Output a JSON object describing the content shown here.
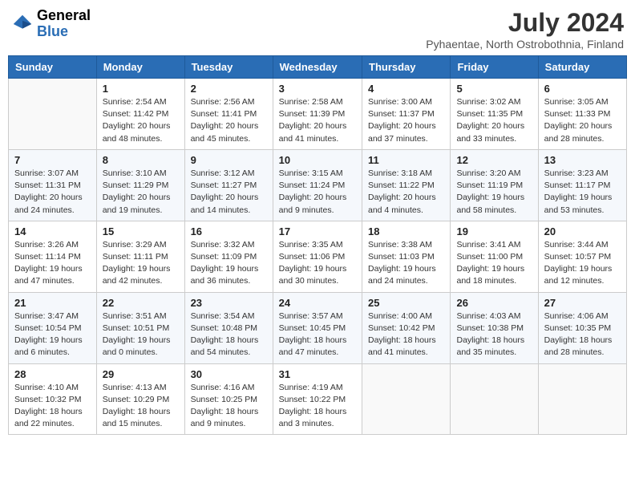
{
  "logo": {
    "text_general": "General",
    "text_blue": "Blue"
  },
  "header": {
    "month_year": "July 2024",
    "location": "Pyhaentae, North Ostrobothnia, Finland"
  },
  "weekdays": [
    "Sunday",
    "Monday",
    "Tuesday",
    "Wednesday",
    "Thursday",
    "Friday",
    "Saturday"
  ],
  "weeks": [
    [
      {
        "day": "",
        "info": ""
      },
      {
        "day": "1",
        "info": "Sunrise: 2:54 AM\nSunset: 11:42 PM\nDaylight: 20 hours\nand 48 minutes."
      },
      {
        "day": "2",
        "info": "Sunrise: 2:56 AM\nSunset: 11:41 PM\nDaylight: 20 hours\nand 45 minutes."
      },
      {
        "day": "3",
        "info": "Sunrise: 2:58 AM\nSunset: 11:39 PM\nDaylight: 20 hours\nand 41 minutes."
      },
      {
        "day": "4",
        "info": "Sunrise: 3:00 AM\nSunset: 11:37 PM\nDaylight: 20 hours\nand 37 minutes."
      },
      {
        "day": "5",
        "info": "Sunrise: 3:02 AM\nSunset: 11:35 PM\nDaylight: 20 hours\nand 33 minutes."
      },
      {
        "day": "6",
        "info": "Sunrise: 3:05 AM\nSunset: 11:33 PM\nDaylight: 20 hours\nand 28 minutes."
      }
    ],
    [
      {
        "day": "7",
        "info": "Sunrise: 3:07 AM\nSunset: 11:31 PM\nDaylight: 20 hours\nand 24 minutes."
      },
      {
        "day": "8",
        "info": "Sunrise: 3:10 AM\nSunset: 11:29 PM\nDaylight: 20 hours\nand 19 minutes."
      },
      {
        "day": "9",
        "info": "Sunrise: 3:12 AM\nSunset: 11:27 PM\nDaylight: 20 hours\nand 14 minutes."
      },
      {
        "day": "10",
        "info": "Sunrise: 3:15 AM\nSunset: 11:24 PM\nDaylight: 20 hours\nand 9 minutes."
      },
      {
        "day": "11",
        "info": "Sunrise: 3:18 AM\nSunset: 11:22 PM\nDaylight: 20 hours\nand 4 minutes."
      },
      {
        "day": "12",
        "info": "Sunrise: 3:20 AM\nSunset: 11:19 PM\nDaylight: 19 hours\nand 58 minutes."
      },
      {
        "day": "13",
        "info": "Sunrise: 3:23 AM\nSunset: 11:17 PM\nDaylight: 19 hours\nand 53 minutes."
      }
    ],
    [
      {
        "day": "14",
        "info": "Sunrise: 3:26 AM\nSunset: 11:14 PM\nDaylight: 19 hours\nand 47 minutes."
      },
      {
        "day": "15",
        "info": "Sunrise: 3:29 AM\nSunset: 11:11 PM\nDaylight: 19 hours\nand 42 minutes."
      },
      {
        "day": "16",
        "info": "Sunrise: 3:32 AM\nSunset: 11:09 PM\nDaylight: 19 hours\nand 36 minutes."
      },
      {
        "day": "17",
        "info": "Sunrise: 3:35 AM\nSunset: 11:06 PM\nDaylight: 19 hours\nand 30 minutes."
      },
      {
        "day": "18",
        "info": "Sunrise: 3:38 AM\nSunset: 11:03 PM\nDaylight: 19 hours\nand 24 minutes."
      },
      {
        "day": "19",
        "info": "Sunrise: 3:41 AM\nSunset: 11:00 PM\nDaylight: 19 hours\nand 18 minutes."
      },
      {
        "day": "20",
        "info": "Sunrise: 3:44 AM\nSunset: 10:57 PM\nDaylight: 19 hours\nand 12 minutes."
      }
    ],
    [
      {
        "day": "21",
        "info": "Sunrise: 3:47 AM\nSunset: 10:54 PM\nDaylight: 19 hours\nand 6 minutes."
      },
      {
        "day": "22",
        "info": "Sunrise: 3:51 AM\nSunset: 10:51 PM\nDaylight: 19 hours\nand 0 minutes."
      },
      {
        "day": "23",
        "info": "Sunrise: 3:54 AM\nSunset: 10:48 PM\nDaylight: 18 hours\nand 54 minutes."
      },
      {
        "day": "24",
        "info": "Sunrise: 3:57 AM\nSunset: 10:45 PM\nDaylight: 18 hours\nand 47 minutes."
      },
      {
        "day": "25",
        "info": "Sunrise: 4:00 AM\nSunset: 10:42 PM\nDaylight: 18 hours\nand 41 minutes."
      },
      {
        "day": "26",
        "info": "Sunrise: 4:03 AM\nSunset: 10:38 PM\nDaylight: 18 hours\nand 35 minutes."
      },
      {
        "day": "27",
        "info": "Sunrise: 4:06 AM\nSunset: 10:35 PM\nDaylight: 18 hours\nand 28 minutes."
      }
    ],
    [
      {
        "day": "28",
        "info": "Sunrise: 4:10 AM\nSunset: 10:32 PM\nDaylight: 18 hours\nand 22 minutes."
      },
      {
        "day": "29",
        "info": "Sunrise: 4:13 AM\nSunset: 10:29 PM\nDaylight: 18 hours\nand 15 minutes."
      },
      {
        "day": "30",
        "info": "Sunrise: 4:16 AM\nSunset: 10:25 PM\nDaylight: 18 hours\nand 9 minutes."
      },
      {
        "day": "31",
        "info": "Sunrise: 4:19 AM\nSunset: 10:22 PM\nDaylight: 18 hours\nand 3 minutes."
      },
      {
        "day": "",
        "info": ""
      },
      {
        "day": "",
        "info": ""
      },
      {
        "day": "",
        "info": ""
      }
    ]
  ]
}
